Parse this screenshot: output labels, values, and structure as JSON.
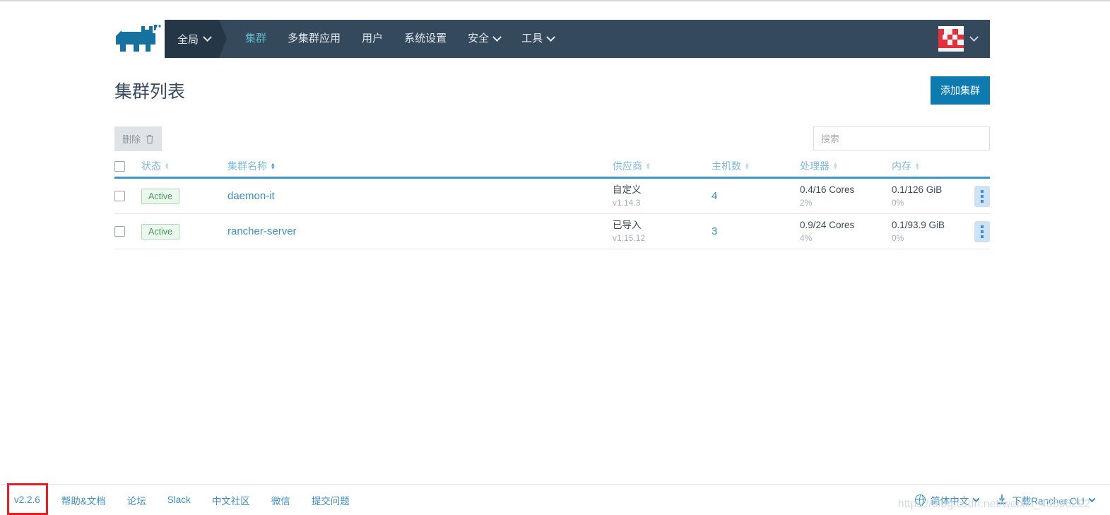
{
  "header": {
    "logo_name": "rancher-cow-logo",
    "scope_selector": {
      "label": "全局",
      "icon": "chevron-down-icon"
    },
    "nav": [
      {
        "label": "集群",
        "active": true,
        "has_caret": false
      },
      {
        "label": "多集群应用",
        "active": false,
        "has_caret": false
      },
      {
        "label": "用户",
        "active": false,
        "has_caret": false
      },
      {
        "label": "系统设置",
        "active": false,
        "has_caret": false
      },
      {
        "label": "安全",
        "active": false,
        "has_caret": true
      },
      {
        "label": "工具",
        "active": false,
        "has_caret": true
      }
    ],
    "avatar_name": "user-avatar",
    "avatar_caret_icon": "chevron-down-icon"
  },
  "page": {
    "title": "集群列表",
    "add_button": "添加集群"
  },
  "toolbar": {
    "delete_label": "删除",
    "delete_icon": "trash-icon",
    "search_placeholder": "搜索",
    "search_value": ""
  },
  "table": {
    "columns": [
      {
        "key": "state",
        "label": "状态",
        "sort": "inactive"
      },
      {
        "key": "name",
        "label": "集群名称",
        "sort": "active"
      },
      {
        "key": "provider",
        "label": "供应商",
        "sort": "inactive"
      },
      {
        "key": "hosts",
        "label": "主机数",
        "sort": "inactive"
      },
      {
        "key": "cpu",
        "label": "处理器",
        "sort": "inactive"
      },
      {
        "key": "memory",
        "label": "内存",
        "sort": "inactive"
      }
    ],
    "rows": [
      {
        "state": "Active",
        "name": "daemon-it",
        "provider": "自定义",
        "provider_version": "v1.14.3",
        "hosts": "4",
        "cpu": "0.4/16 Cores",
        "cpu_pct": "2%",
        "memory": "0.1/126 GiB",
        "memory_pct": "0%"
      },
      {
        "state": "Active",
        "name": "rancher-server",
        "provider": "已导入",
        "provider_version": "v1.15.12",
        "hosts": "3",
        "cpu": "0.9/24 Cores",
        "cpu_pct": "4%",
        "memory": "0.1/93.9 GiB",
        "memory_pct": "0%"
      }
    ]
  },
  "footer": {
    "version": "v2.2.6",
    "links": [
      "帮助&文档",
      "论坛",
      "Slack",
      "中文社区",
      "微信",
      "提交问题"
    ],
    "language": {
      "label": "简体中文",
      "icon": "globe-icon",
      "caret": "chevron-down-icon"
    },
    "download": {
      "label": "下载Rancher CLI",
      "icon": "download-icon",
      "caret": "chevron-down-icon"
    },
    "watermark": "https://blog.csdn.net/weixin_43556292"
  },
  "colors": {
    "header_bg": "#35495c",
    "scope_bg": "#253746",
    "accent_teal": "#5eb9c9",
    "primary_blue": "#0d7ab0",
    "link_blue": "#3d8dc4",
    "badge_green": "#4c9b5c",
    "annotation_red": "#ee1b24"
  }
}
